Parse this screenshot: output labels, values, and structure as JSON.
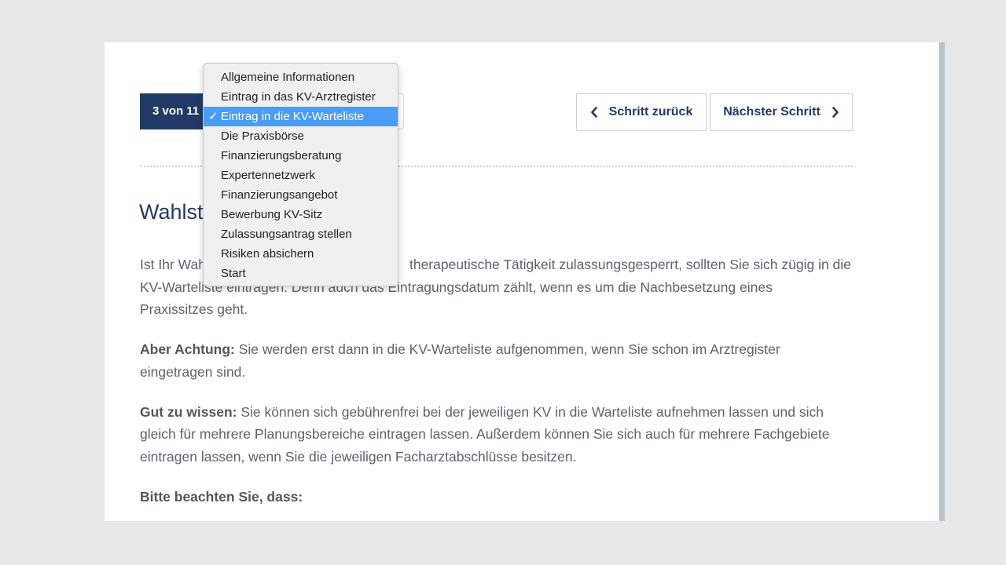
{
  "stepper": {
    "counter": "3 von 11",
    "prev_label": "Schritt zurück",
    "next_label": "Nächster Schritt"
  },
  "dropdown": {
    "selected_index": 2,
    "check_mark": "✓",
    "options": [
      "Allgemeine Informationen",
      "Eintrag in das KV-Arztregister",
      "Eintrag in die KV-Warteliste",
      "Die Praxisbörse",
      "Finanzierungsberatung",
      "Expertennetzwerk",
      "Finanzierungsangebot",
      "Bewerbung KV-Sitz",
      "Zulassungsantrag stellen",
      "Risiken absichern",
      "Start"
    ]
  },
  "article": {
    "heading": "Wahlst",
    "p1_line1_left": "Ist Ihr Wah",
    "p1_line1_right": "therapeutische Tätigkeit zulassungsgesperrt, sollten Sie sich zügig in die",
    "p1_line2_left": "KV-Warteliste eintragen. Denn auch das Eintragungsdatum zählt, wenn es um die Nachbesetzung eines",
    "p1_line3": "Praxissitzes geht.",
    "p2_bold": "Aber Achtung:",
    "p2_text": " Sie werden erst dann in die KV-Warteliste aufgenommen, wenn Sie schon im Arztregister eingetragen sind.",
    "p3_bold": "Gut zu wissen:",
    "p3_text": " Sie können sich gebührenfrei bei der jeweiligen KV in die Warteliste aufnehmen lassen und sich gleich für mehrere Planungsbereiche eintragen lassen. Außerdem können Sie sich auch für mehrere Fachgebiete eintragen lassen, wenn Sie die jeweiligen Facharztabschlüsse besitzen.",
    "p4_bold": "Bitte beachten Sie, dass:"
  },
  "colors": {
    "brand": "#223a66",
    "selection": "#4a9df6"
  },
  "icons": {
    "prev": "chevron-left-icon",
    "next": "chevron-right-icon"
  }
}
